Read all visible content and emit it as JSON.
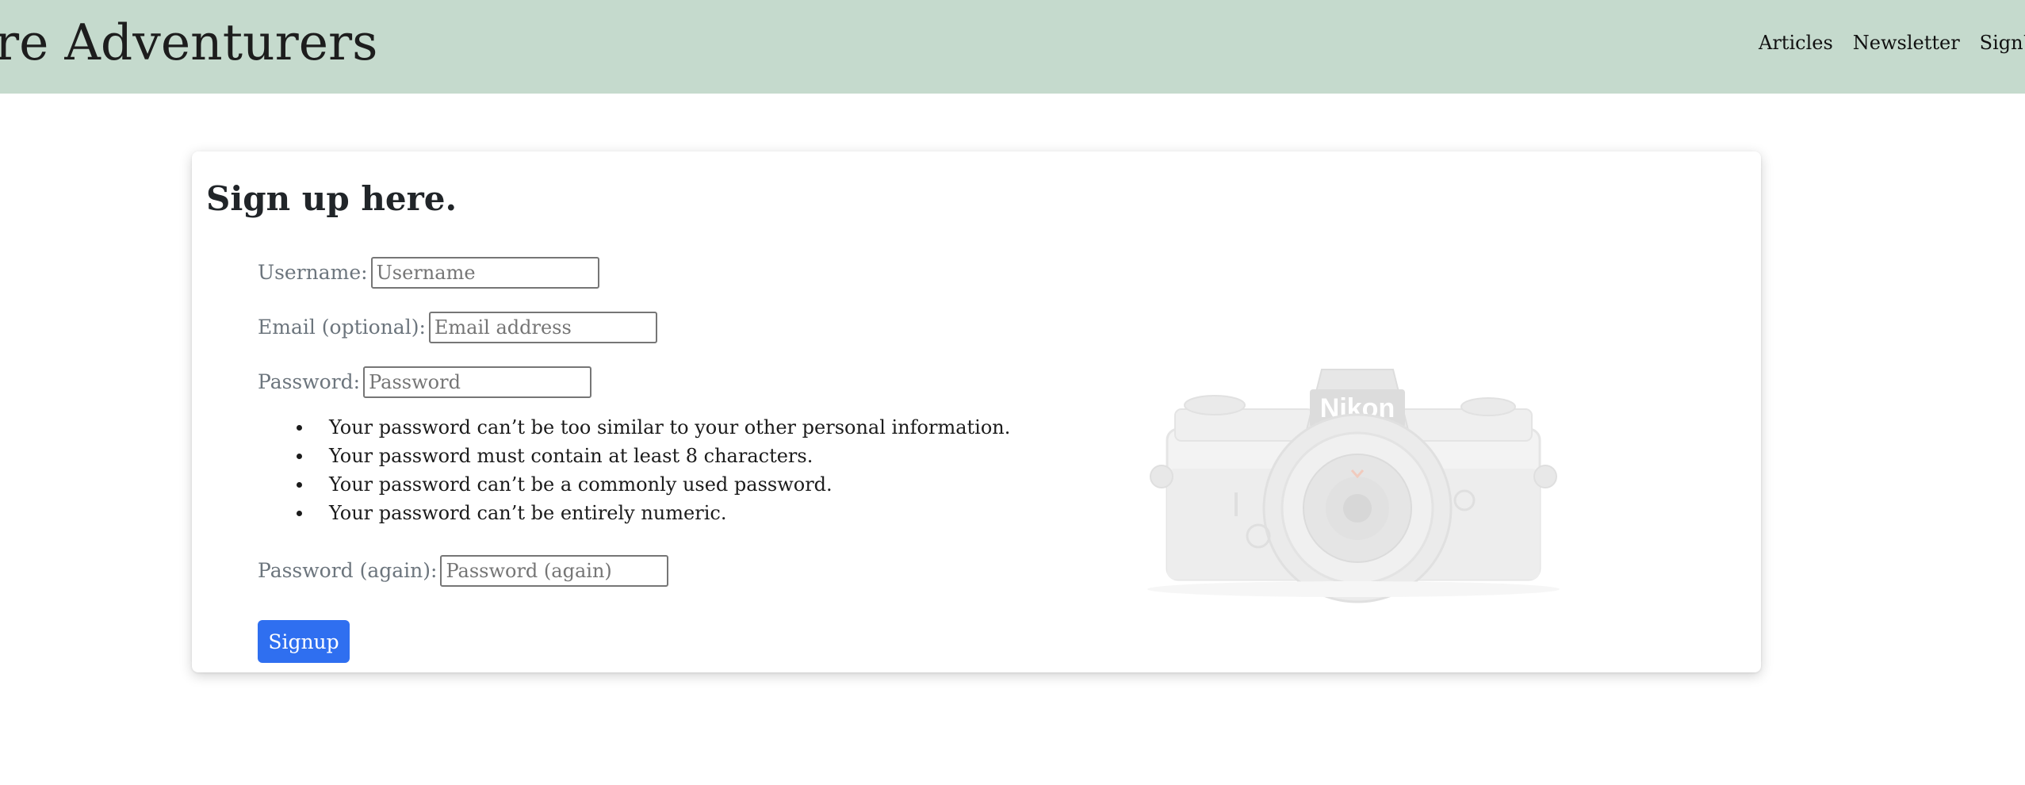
{
  "header": {
    "brand": "re Adventurers",
    "nav": [
      {
        "label": "Articles"
      },
      {
        "label": "Newsletter"
      },
      {
        "label": "SignUp"
      }
    ]
  },
  "form": {
    "heading": "Sign up here.",
    "username": {
      "label": "Username:",
      "placeholder": "Username",
      "value": ""
    },
    "email": {
      "label": "Email (optional):",
      "placeholder": "Email address",
      "value": ""
    },
    "password": {
      "label": "Password:",
      "placeholder": "Password",
      "value": ""
    },
    "hints": [
      "Your password can’t be too similar to your other personal information.",
      "Your password must contain at least 8 characters.",
      "Your password can’t be a commonly used password.",
      "Your password can’t be entirely numeric."
    ],
    "password_again": {
      "label": "Password (again):",
      "placeholder": "Password (again)",
      "value": ""
    },
    "submit_label": "Signup"
  },
  "illustration": {
    "brand_text": "Nikon",
    "icon": "camera-icon"
  },
  "colors": {
    "header_bg": "#c5dacd",
    "button_bg": "#2f6ff0",
    "label_text": "#6c757d"
  }
}
